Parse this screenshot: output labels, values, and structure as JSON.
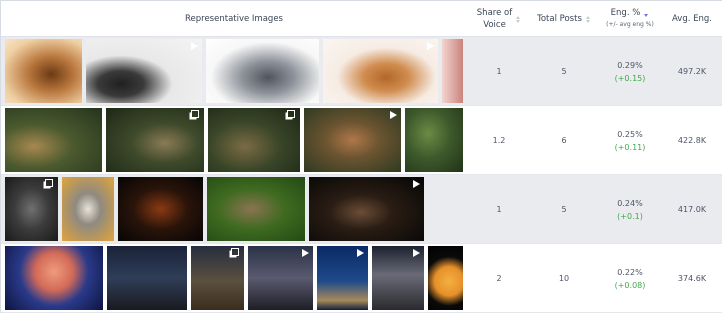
{
  "headers": {
    "images": "Representative Images",
    "share_of_voice_line1": "Share of",
    "share_of_voice_line2": "Voice",
    "total_posts": "Total Posts",
    "eng_pct": "Eng. %",
    "eng_pct_sub": "(+/- avg eng %)",
    "avg_eng": "Avg. Eng."
  },
  "rows": [
    {
      "share_of_voice": "1",
      "total_posts": "5",
      "eng_pct": "0.29%",
      "eng_delta": "(+0.15)",
      "avg_eng": "497.2K",
      "thumbs": [
        {
          "subject": "insect-closeup",
          "overlay": "none"
        },
        {
          "subject": "turtle-hatchling",
          "overlay": "play-icon"
        },
        {
          "subject": "softshell-turtle",
          "overlay": "none"
        },
        {
          "subject": "orange-frog",
          "overlay": "play-icon"
        },
        {
          "subject": "partial-image",
          "overlay": "none"
        }
      ]
    },
    {
      "share_of_voice": "1.2",
      "total_posts": "6",
      "eng_pct": "0.25%",
      "eng_delta": "(+0.11)",
      "avg_eng": "422.8K",
      "thumbs": [
        {
          "subject": "puma-jungle",
          "overlay": "none"
        },
        {
          "subject": "puma-forest",
          "overlay": "multi-icon"
        },
        {
          "subject": "mangrove-forest",
          "overlay": "multi-icon"
        },
        {
          "subject": "children-water",
          "overlay": "play-icon"
        },
        {
          "subject": "jungle-pond",
          "overlay": "none"
        }
      ]
    },
    {
      "share_of_voice": "1",
      "total_posts": "5",
      "eng_pct": "0.24%",
      "eng_delta": "(+0.1)",
      "avg_eng": "417.0K",
      "thumbs": [
        {
          "subject": "grizzly-bear",
          "overlay": "multi-icon"
        },
        {
          "subject": "lemur",
          "overlay": "none"
        },
        {
          "subject": "muscle-arms",
          "overlay": "none"
        },
        {
          "subject": "wild-dog",
          "overlay": "none"
        },
        {
          "subject": "baby-monkey",
          "overlay": "play-icon"
        }
      ]
    },
    {
      "share_of_voice": "2",
      "total_posts": "10",
      "eng_pct": "0.22%",
      "eng_delta": "(+0.08)",
      "avg_eng": "374.6K",
      "thumbs": [
        {
          "subject": "pink-moon",
          "overlay": "none"
        },
        {
          "subject": "milky-way-lake",
          "overlay": "none"
        },
        {
          "subject": "desert-night",
          "overlay": "multi-icon"
        },
        {
          "subject": "stargazer",
          "overlay": "play-icon"
        },
        {
          "subject": "night-town",
          "overlay": "play-icon"
        },
        {
          "subject": "night-sky",
          "overlay": "play-icon"
        },
        {
          "subject": "golden-moon",
          "overlay": "none"
        }
      ]
    }
  ],
  "colors": {
    "delta_positive": "#3fa94a",
    "sort_active": "#7b6ee8",
    "row_alt_bg": "#e9ebef"
  }
}
